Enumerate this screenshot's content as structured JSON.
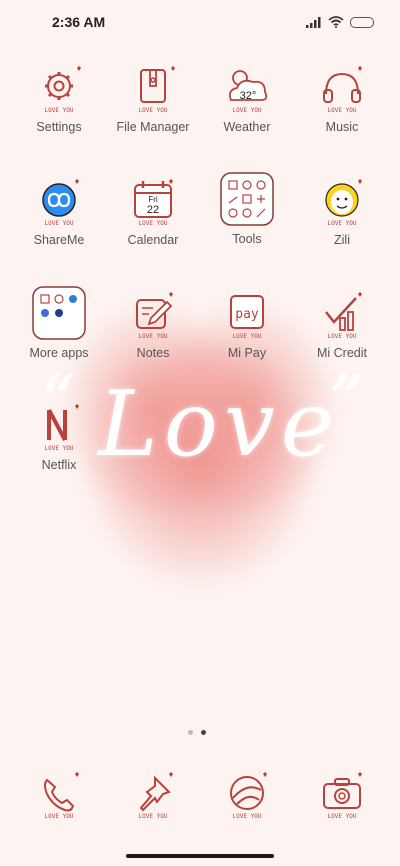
{
  "status_bar": {
    "time": "2:36 AM",
    "signal_icon": "signal-icon",
    "wifi_icon": "wifi-icon",
    "battery_icon": "battery-icon"
  },
  "wallpaper": {
    "text": "Love"
  },
  "icon_caption": "LOVE YOU",
  "apps": [
    {
      "label": "Settings",
      "icon": "gear-icon"
    },
    {
      "label": "File Manager",
      "icon": "file-manager-icon"
    },
    {
      "label": "Weather",
      "icon": "weather-icon",
      "temp": "32°"
    },
    {
      "label": "Music",
      "icon": "headphones-icon"
    },
    {
      "label": "ShareMe",
      "icon": "shareme-icon"
    },
    {
      "label": "Calendar",
      "icon": "calendar-icon",
      "day": "Fri",
      "date": "22"
    },
    {
      "label": "Tools",
      "icon": "tools-folder-icon"
    },
    {
      "label": "Zili",
      "icon": "zili-icon"
    },
    {
      "label": "More apps",
      "icon": "more-apps-folder-icon"
    },
    {
      "label": "Notes",
      "icon": "notes-icon"
    },
    {
      "label": "Mi Pay",
      "icon": "mi-pay-icon",
      "text": "pay"
    },
    {
      "label": "Mi Credit",
      "icon": "mi-credit-icon"
    },
    {
      "label": "Netflix",
      "icon": "netflix-icon"
    }
  ],
  "dock": [
    {
      "name": "phone",
      "icon": "phone-icon"
    },
    {
      "name": "pin",
      "icon": "pin-icon"
    },
    {
      "name": "browser",
      "icon": "browser-icon"
    },
    {
      "name": "camera",
      "icon": "camera-icon"
    }
  ],
  "pages": {
    "count": 2,
    "active": 2
  },
  "colors": {
    "accent": "#b8433e",
    "background": "#fdf3f1"
  }
}
